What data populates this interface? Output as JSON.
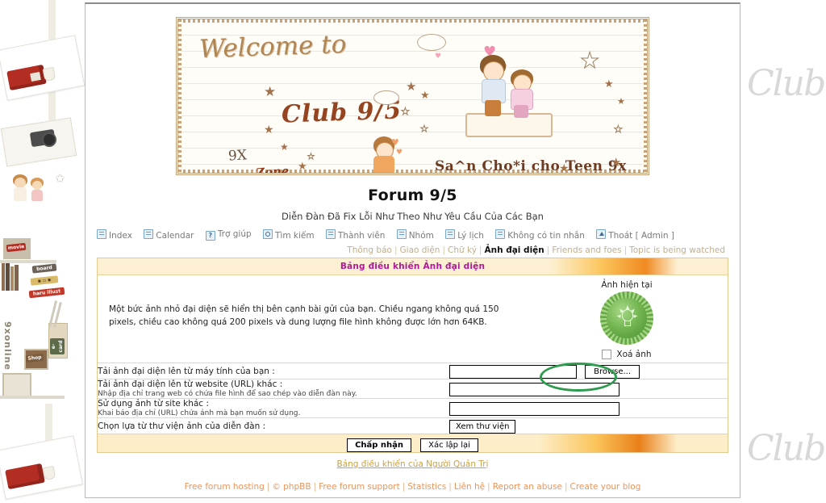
{
  "page": {
    "site_title": "Forum 9/5",
    "subtitle": "Diễn Đàn Đã Fix Lỗi Như Theo Như Yêu Cầu Của Các Bạn"
  },
  "banner": {
    "welcome": "Welcome to",
    "club": "Club 9/5",
    "nine_x": "9X",
    "zone": "Zone",
    "tagline": "Sa^n Cho*i cho Teen 9x"
  },
  "wallpaper": {
    "watermark": "Club",
    "labels": [
      "movie",
      "board",
      "haru illust",
      "Shop",
      "e-card",
      "9xonline",
      "9x"
    ]
  },
  "nav": [
    {
      "label": "Index",
      "icon": "home-icon"
    },
    {
      "label": "Calendar",
      "icon": "calendar-icon"
    },
    {
      "label": "Trợ giúp",
      "icon": "help-icon"
    },
    {
      "label": "Tìm kiếm",
      "icon": "search-icon"
    },
    {
      "label": "Thành viên",
      "icon": "members-icon"
    },
    {
      "label": "Nhóm",
      "icon": "groups-icon"
    },
    {
      "label": "Lý lịch",
      "icon": "profile-icon"
    },
    {
      "label": "Không có tin nhắn",
      "icon": "messages-icon"
    },
    {
      "label": "Thoát [ Admin ]",
      "icon": "logout-icon"
    }
  ],
  "subnav": {
    "items": [
      {
        "label": "Thông báo",
        "active": false
      },
      {
        "label": "Giao diện",
        "active": false
      },
      {
        "label": "Chữ ký",
        "active": false
      },
      {
        "label": "Ảnh đại diện",
        "active": true
      },
      {
        "label": "Friends and foes",
        "active": false
      },
      {
        "label": "Topic is being watched",
        "active": false
      }
    ],
    "separator": "|"
  },
  "panel": {
    "title": "Bảng điều khiển Ảnh đại diện",
    "intro": "Một bức ảnh nhỏ đại diện sẽ hiển thị bên cạnh bài gửi của bạn. Chiều ngang không quá 150 pixels, chiều cao không quá 200 pixels và dung lượng file hình không được lớn hơn 64KB.",
    "avatar_label": "Ảnh hiện tại",
    "avatar_icon": "green-lightbulb-badge-icon",
    "delete_label": "Xoá ảnh",
    "rows": [
      {
        "label": "Tải ảnh đại diện lên từ máy tính của bạn :",
        "hint": "",
        "input_value": "",
        "button": "Browse..."
      },
      {
        "label": "Tải ảnh đại diện lên từ website (URL) khác :",
        "hint": "Nhập địa chỉ trang web có chứa file hình để sao chép vào diễn đàn này.",
        "input_value": "",
        "button": ""
      },
      {
        "label": "Sử dụng ảnh từ site khác :",
        "hint": "Khai báo địa chỉ (URL) chứa ảnh mà bạn muốn sử dụng.",
        "input_value": "",
        "button": ""
      },
      {
        "label": "Chọn lựa từ thư viện ảnh của diễn đàn :",
        "hint": "",
        "input_value": null,
        "button": "Xem thư viện"
      }
    ],
    "submit_label": "Chấp nhận",
    "reset_label": "Xác lập lại"
  },
  "admin_cp_link": "Bảng điều khiển của Người Quản Trị",
  "footer": {
    "items": [
      "Free forum hosting",
      "© phpBB",
      "Free forum support",
      "Statistics",
      "Liên hệ",
      "Report an abuse",
      "Create your blog"
    ],
    "separator": "|"
  },
  "annotation": {
    "shape": "ellipse",
    "color": "#2e9b4f",
    "targets": "Browse... button"
  },
  "colors": {
    "panel_border": "#e3c98f",
    "panel_title_text": "#b0179b",
    "accent_orange": "#f08a22",
    "footer_link": "#e8955e",
    "annotation_green": "#2e9b4f"
  }
}
